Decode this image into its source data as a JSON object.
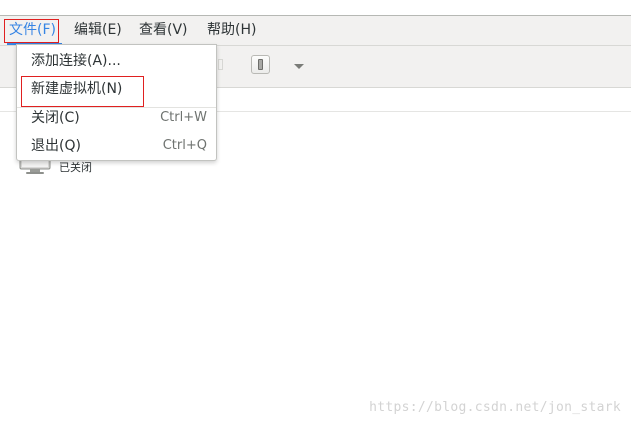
{
  "menubar": {
    "items": [
      {
        "label": "文件(F)",
        "active": true
      },
      {
        "label": "编辑(E)"
      },
      {
        "label": "查看(V)"
      },
      {
        "label": "帮助(H)"
      }
    ]
  },
  "file_menu": {
    "items": [
      {
        "label": "添加连接(A)...",
        "shortcut": ""
      },
      {
        "label": "新建虚拟机(N)",
        "shortcut": "",
        "highlighted": true
      },
      {
        "label": "关闭(C)",
        "shortcut": "Ctrl+W"
      },
      {
        "label": "退出(Q)",
        "shortcut": "Ctrl+Q"
      }
    ]
  },
  "vm_list": {
    "rows": [
      {
        "status": "已关闭",
        "icon": "monitor-icon"
      }
    ]
  },
  "watermark": "https://blog.csdn.net/jon_stark",
  "colors": {
    "accent": "#3584e4",
    "annotation_red": "#e02020",
    "menubar_bg": "#f2f1f0"
  }
}
